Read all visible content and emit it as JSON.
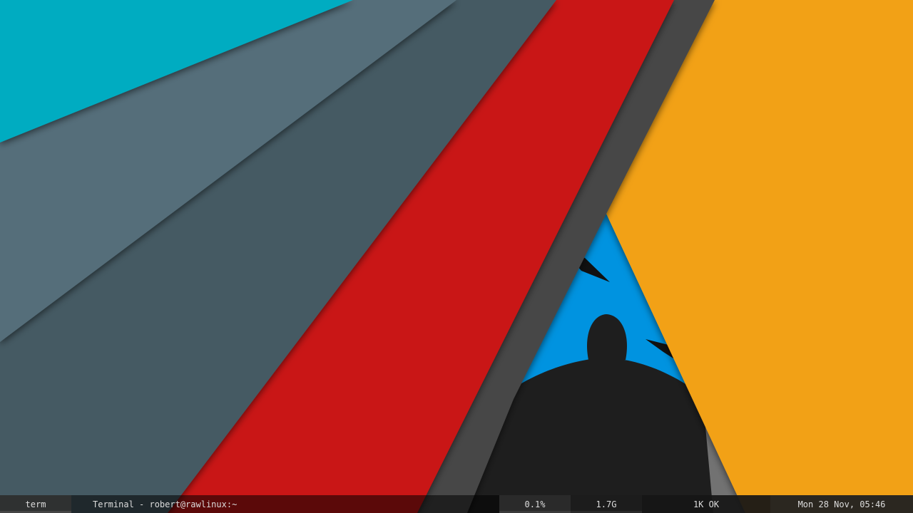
{
  "panel": {
    "workspace": "term",
    "window_title": "Terminal - robert@rawlinux:~",
    "cpu_usage": "0.1%",
    "memory_used": "1.7G",
    "network_status": "1K OK",
    "clock": "Mon 28 Nov, 05:46"
  },
  "colors": {
    "teal": "#00acc1",
    "slate_light": "#546e7a",
    "slate_dark": "#455a64",
    "red": "#c91414",
    "charcoal": "#474747",
    "orange": "#f2a117",
    "arch_blue": "#0093e0",
    "arch_gray": "#727272",
    "arch_black": "#1e1e1e"
  },
  "icons": {
    "wallpaper_logo": "arch-linux-logo-icon"
  }
}
